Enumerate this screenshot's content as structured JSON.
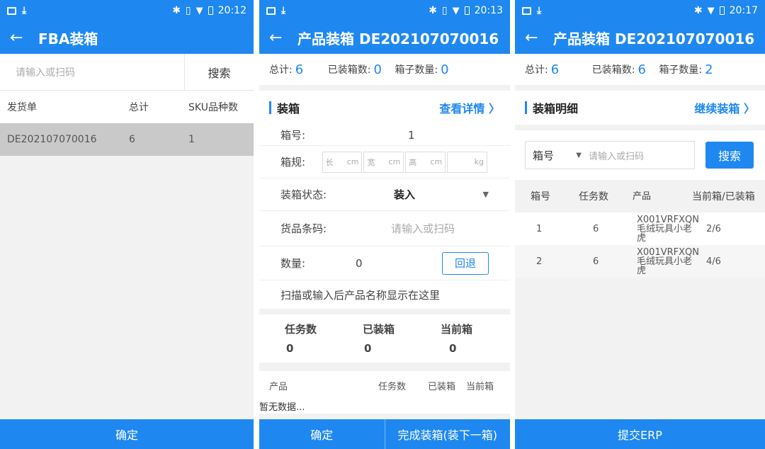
{
  "status_bars": [
    {
      "time": "20:12"
    },
    {
      "time": "20:13"
    },
    {
      "time": "20:17"
    }
  ],
  "panel1": {
    "title": "FBA装箱",
    "search_placeholder": "请输入或扫码",
    "search_button": "搜索",
    "columns": [
      "发货单",
      "总计",
      "SKU品种数"
    ],
    "rows": [
      {
        "order": "DE202107070016",
        "total": "6",
        "sku_count": "1"
      }
    ],
    "confirm": "确定"
  },
  "panel2": {
    "title": "产品装箱 DE202107070016",
    "summary": {
      "total_label": "总计:",
      "total": "6",
      "packed_label": "已装箱数:",
      "packed": "0",
      "boxes_label": "箱子数量:",
      "boxes": "0"
    },
    "section_title": "装箱",
    "details_link": "查看详情 〉",
    "box_no_label": "箱号:",
    "box_no": "1",
    "spec_label": "箱规:",
    "dims": [
      {
        "prefix": "长",
        "unit": "cm"
      },
      {
        "prefix": "宽",
        "unit": "cm"
      },
      {
        "prefix": "高",
        "unit": "cm"
      },
      {
        "prefix": "",
        "unit": "kg"
      }
    ],
    "status_label": "装箱状态:",
    "status_value": "装入",
    "barcode_label": "货品条码:",
    "barcode_placeholder": "请输入或扫码",
    "qty_label": "数量:",
    "qty_value": "0",
    "undo_button": "回退",
    "hint": "扫描或输入后产品名称显示在这里",
    "stats_headers": [
      "任务数",
      "已装箱",
      "当前箱"
    ],
    "stats_values": [
      "0",
      "0",
      "0"
    ],
    "product_headers": [
      "产品",
      "任务数",
      "已装箱",
      "当前箱"
    ],
    "empty_text": "暂无数据...",
    "confirm": "确定",
    "finish": "完成装箱(装下一箱)"
  },
  "panel3": {
    "title": "产品装箱 DE202107070016",
    "summary": {
      "total_label": "总计:",
      "total": "6",
      "packed_label": "已装箱数:",
      "packed": "6",
      "boxes_label": "箱子数量:",
      "boxes": "2"
    },
    "section_title": "装箱明细",
    "continue_link": "继续装箱 〉",
    "select_value": "箱号",
    "search_placeholder": "请输入或扫码",
    "search_button": "搜索",
    "columns": [
      "箱号",
      "任务数",
      "产品",
      "当前箱/已装箱"
    ],
    "rows": [
      {
        "box": "1",
        "tasks": "6",
        "product": "X001VRFXQN 毛绒玩具小老虎",
        "progress": "2/6"
      },
      {
        "box": "2",
        "tasks": "6",
        "product": "X001VRFXQN 毛绒玩具小老虎",
        "progress": "4/6"
      }
    ],
    "submit": "提交ERP"
  }
}
